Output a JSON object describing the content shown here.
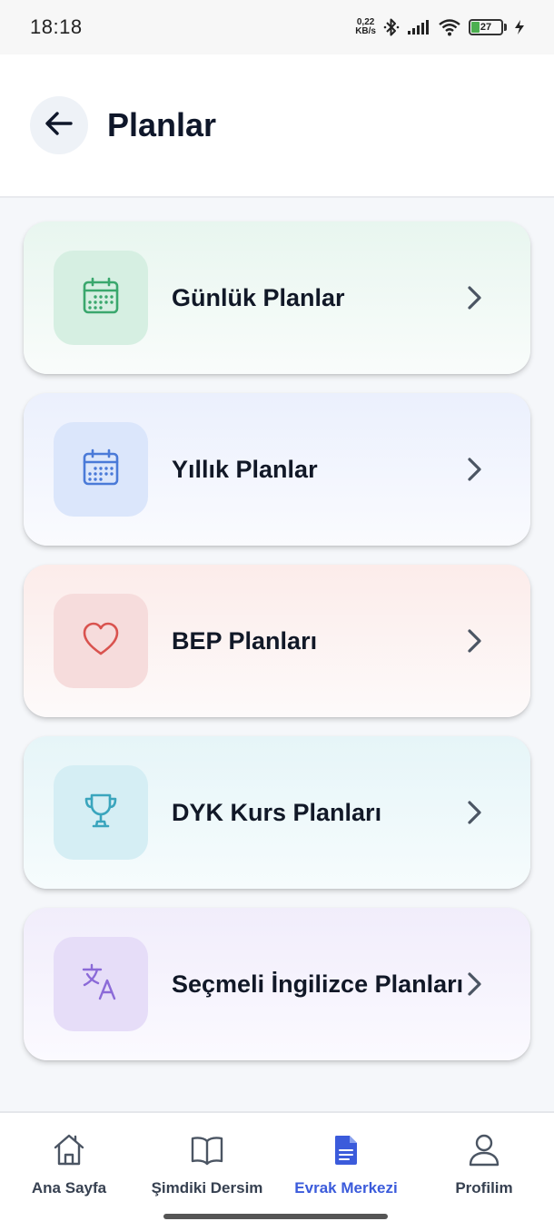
{
  "status_bar": {
    "time": "18:18",
    "net_speed_value": "0,22",
    "net_speed_unit": "KB/s",
    "battery_level": "27"
  },
  "header": {
    "title": "Planlar",
    "back_icon": "arrow-left-icon"
  },
  "plans": [
    {
      "label": "Günlük Planlar",
      "icon": "calendar-icon",
      "color": "#3aa76d"
    },
    {
      "label": "Yıllık Planlar",
      "icon": "calendar-icon",
      "color": "#4a7ad8"
    },
    {
      "label": "BEP Planları",
      "icon": "heart-icon",
      "color": "#d9534f"
    },
    {
      "label": "DYK Kurs Planları",
      "icon": "trophy-icon",
      "color": "#3aa5bd"
    },
    {
      "label": "Seçmeli İngilizce Planları",
      "icon": "translate-icon",
      "color": "#8b6ad8"
    }
  ],
  "bottom_nav": {
    "items": [
      {
        "label": "Ana Sayfa",
        "icon": "home-icon",
        "active": false
      },
      {
        "label": "Şimdiki Dersim",
        "icon": "book-icon",
        "active": false
      },
      {
        "label": "Evrak Merkezi",
        "icon": "document-icon",
        "active": true
      },
      {
        "label": "Profilim",
        "icon": "user-icon",
        "active": false
      }
    ],
    "active_color": "#3b5bdb"
  }
}
